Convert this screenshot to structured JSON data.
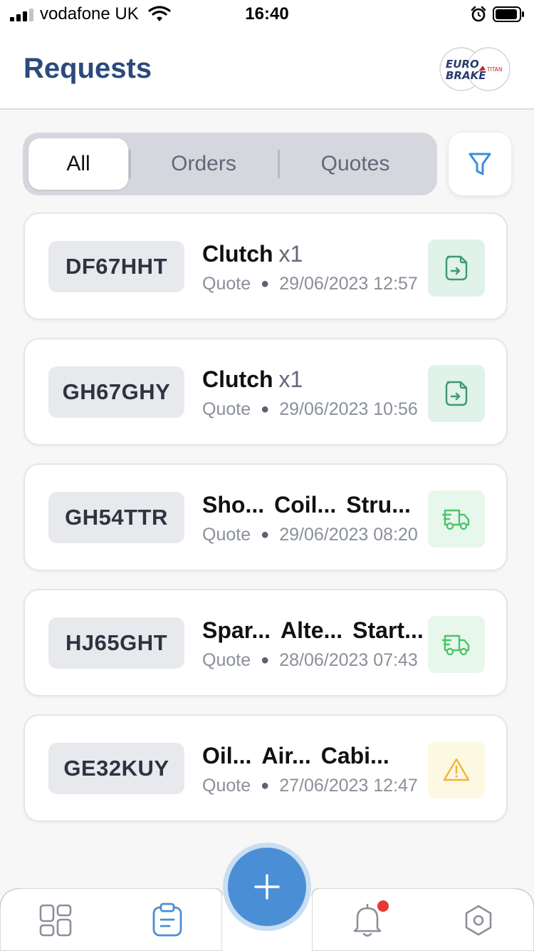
{
  "status_bar": {
    "carrier": "vodafone UK",
    "time": "16:40"
  },
  "header": {
    "title": "Requests",
    "logo_text_1": "EURO",
    "logo_text_2": "BRAKE",
    "logo_text_3": "TITAN"
  },
  "tabs": {
    "all": "All",
    "orders": "Orders",
    "quotes": "Quotes",
    "active": "All"
  },
  "requests": [
    {
      "plate": "DF67HHT",
      "items": [
        "Clutch"
      ],
      "qty": "x1",
      "type": "Quote",
      "datetime": "29/06/2023 12:57",
      "status_icon": "document-icon",
      "status_color": "#3c9a6f"
    },
    {
      "plate": "GH67GHY",
      "items": [
        "Clutch"
      ],
      "qty": "x1",
      "type": "Quote",
      "datetime": "29/06/2023 10:56",
      "status_icon": "document-icon",
      "status_color": "#3c9a6f"
    },
    {
      "plate": "GH54TTR",
      "items": [
        "Sho...",
        "Coil...",
        "Stru..."
      ],
      "type": "Quote",
      "datetime": "29/06/2023 08:20",
      "status_icon": "delivery-truck-icon",
      "status_color": "#4cc36a"
    },
    {
      "plate": "HJ65GHT",
      "items": [
        "Spar...",
        "Alte...",
        "Start..."
      ],
      "type": "Quote",
      "datetime": "28/06/2023 07:43",
      "status_icon": "delivery-truck-icon",
      "status_color": "#4cc36a"
    },
    {
      "plate": "GE32KUY",
      "items": [
        "Oil...",
        "Air...",
        "Cabi..."
      ],
      "type": "Quote",
      "datetime": "27/06/2023 12:47",
      "status_icon": "warning-icon",
      "status_color": "#f0b43a"
    }
  ],
  "nav": {
    "items": [
      "dashboard-icon",
      "requests-icon",
      "add-icon",
      "notifications-icon",
      "settings-icon"
    ],
    "active": "requests-icon",
    "accent": "#4a8fd6"
  }
}
